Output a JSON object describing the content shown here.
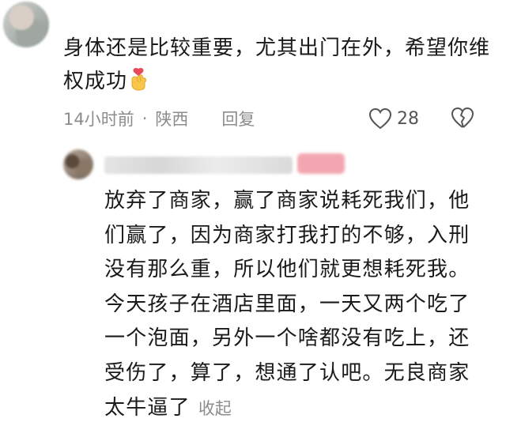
{
  "comment": {
    "text": "身体还是比较重要，尤其出门在外，希望你维权成功",
    "time": "14小时前",
    "separator": "·",
    "location": "陕西",
    "reply_label": "回复",
    "likes": "28"
  },
  "reply": {
    "text": "放弃了商家，赢了商家说耗死我们，他们赢了，因为商家打我打的不够，入刑没有那么重，所以他们就更想耗死我。今天孩子在酒店里面，一天又两个吃了一个泡面，另外一个啥都没有吃上，还受伤了，算了，想通了认吧。无良商家太牛逼了",
    "collapse_label": "收起"
  },
  "icons": {
    "like": "heart-outline-icon",
    "dislike": "broken-heart-icon",
    "emoji": "finger-heart-emoji-icon"
  }
}
